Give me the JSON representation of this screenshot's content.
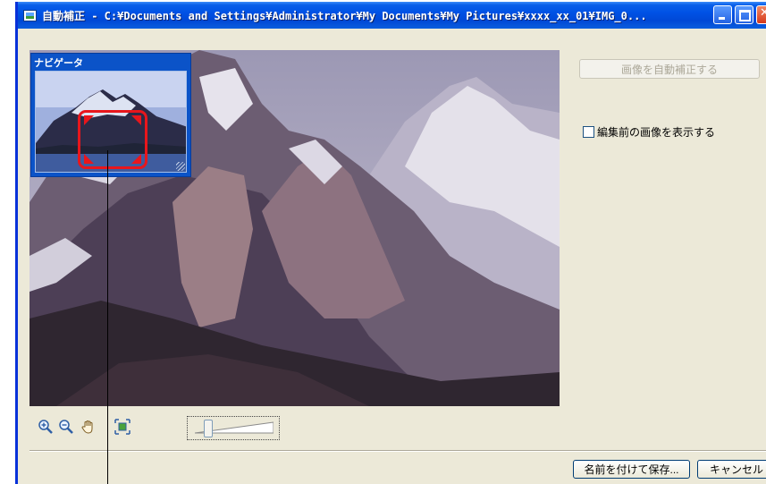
{
  "window": {
    "title": "自動補正 - C:¥Documents and Settings¥Administrator¥My Documents¥My Pictures¥xxxx_xx_01¥IMG_0..."
  },
  "navigator": {
    "title": "ナビゲータ"
  },
  "sidebar": {
    "auto_correct_button": "画像を自動補正する",
    "show_original_label": "編集前の画像を表示する",
    "show_original_checked": false
  },
  "toolbar": {
    "icons": [
      "zoom-in-icon",
      "zoom-out-icon",
      "hand-pan-icon",
      "fit-to-window-icon"
    ]
  },
  "footer": {
    "save_as_label": "名前を付けて保存...",
    "cancel_label": "キャンセル"
  },
  "colors": {
    "titlebar": "#0052E5",
    "navigator": "#0B53C8",
    "viewport_marker": "#E8161C",
    "dialog_bg": "#ECE9D8"
  }
}
